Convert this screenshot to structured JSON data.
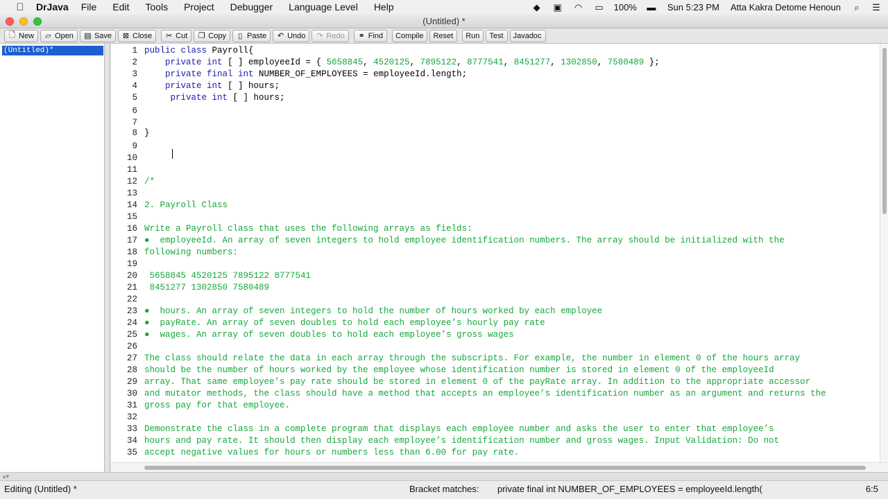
{
  "menubar": {
    "app_name": "DrJava",
    "items": [
      "File",
      "Edit",
      "Tools",
      "Project",
      "Debugger",
      "Language Level",
      "Help"
    ],
    "battery": "100%",
    "clock": "Sun 5:23 PM",
    "user": "Atta Kakra Detome Henoun"
  },
  "window": {
    "title": "(Untitled) *"
  },
  "toolbar": {
    "buttons": [
      {
        "label": "New",
        "icon": "new-file-icon"
      },
      {
        "label": "Open",
        "icon": "open-folder-icon"
      },
      {
        "label": "Save",
        "icon": "save-icon"
      },
      {
        "label": "Close",
        "icon": "close-doc-icon"
      },
      {
        "label": "Cut",
        "icon": "scissors-icon"
      },
      {
        "label": "Copy",
        "icon": "copy-icon"
      },
      {
        "label": "Paste",
        "icon": "paste-icon"
      },
      {
        "label": "Undo",
        "icon": "undo-icon"
      },
      {
        "label": "Redo",
        "icon": "redo-icon",
        "disabled": true
      },
      {
        "label": "Find",
        "icon": "binoculars-icon"
      },
      {
        "label": "Compile"
      },
      {
        "label": "Reset"
      },
      {
        "label": "Run"
      },
      {
        "label": "Test"
      },
      {
        "label": "Javadoc"
      }
    ]
  },
  "documents": [
    "(Untitled)*"
  ],
  "editor": {
    "lines": [
      {
        "n": "1",
        "segs": [
          [
            "kw",
            "public class "
          ],
          [
            "",
            "Payroll{"
          ]
        ]
      },
      {
        "n": "2",
        "segs": [
          [
            "",
            "    "
          ],
          [
            "kw",
            "private int"
          ],
          [
            "",
            " [ ] employeeId = { "
          ],
          [
            "num",
            "5658845"
          ],
          [
            "",
            ", "
          ],
          [
            "num",
            "4520125"
          ],
          [
            "",
            ", "
          ],
          [
            "num",
            "7895122"
          ],
          [
            "",
            ", "
          ],
          [
            "num",
            "8777541"
          ],
          [
            "",
            ", "
          ],
          [
            "num",
            "8451277"
          ],
          [
            "",
            ", "
          ],
          [
            "num",
            "1302850"
          ],
          [
            "",
            ", "
          ],
          [
            "num",
            "7580489"
          ],
          [
            "",
            " };"
          ]
        ]
      },
      {
        "n": "3",
        "segs": [
          [
            "",
            "    "
          ],
          [
            "kw",
            "private final int"
          ],
          [
            "",
            " NUMBER_OF_EMPLOYEES = employeeId.length;"
          ]
        ]
      },
      {
        "n": "4",
        "segs": [
          [
            "",
            "    "
          ],
          [
            "kw",
            "private int"
          ],
          [
            "",
            " [ ] hours;"
          ]
        ]
      },
      {
        "n": "5",
        "segs": [
          [
            "",
            "     "
          ],
          [
            "kw",
            "private int"
          ],
          [
            "",
            " [ ] hours;"
          ]
        ]
      },
      {
        "n": "6",
        "segs": [
          [
            "",
            ""
          ]
        ]
      },
      {
        "n": "7",
        "segs": [
          [
            "",
            ""
          ]
        ]
      },
      {
        "n": "8",
        "segs": [
          [
            "",
            "}"
          ]
        ]
      },
      {
        "n": "9",
        "segs": [
          [
            "",
            ""
          ]
        ]
      },
      {
        "n": "10",
        "segs": [
          [
            "",
            ""
          ]
        ]
      },
      {
        "n": "11",
        "segs": [
          [
            "",
            ""
          ]
        ]
      },
      {
        "n": "12",
        "segs": [
          [
            "cm",
            "/*"
          ]
        ]
      },
      {
        "n": "13",
        "segs": [
          [
            "",
            ""
          ]
        ]
      },
      {
        "n": "14",
        "segs": [
          [
            "cm",
            "2. Payroll Class"
          ]
        ]
      },
      {
        "n": "15",
        "segs": [
          [
            "",
            ""
          ]
        ]
      },
      {
        "n": "16",
        "segs": [
          [
            "cm",
            "Write a Payroll class that uses the following arrays as fields:"
          ]
        ]
      },
      {
        "n": "17",
        "segs": [
          [
            "cm",
            "●  employeeId. An array of seven integers to hold employee identification numbers. The array should be initialized with the"
          ]
        ]
      },
      {
        "n": "18",
        "segs": [
          [
            "cm",
            "following numbers:"
          ]
        ]
      },
      {
        "n": "19",
        "segs": [
          [
            "",
            ""
          ]
        ]
      },
      {
        "n": "20",
        "segs": [
          [
            "cm",
            " 5658845 4520125 7895122 8777541"
          ]
        ]
      },
      {
        "n": "21",
        "segs": [
          [
            "cm",
            " 8451277 1302850 7580489"
          ]
        ]
      },
      {
        "n": "22",
        "segs": [
          [
            "",
            ""
          ]
        ]
      },
      {
        "n": "23",
        "segs": [
          [
            "cm",
            "●  hours. An array of seven integers to hold the number of hours worked by each employee"
          ]
        ]
      },
      {
        "n": "24",
        "segs": [
          [
            "cm",
            "●  payRate. An array of seven doubles to hold each employee’s hourly pay rate"
          ]
        ]
      },
      {
        "n": "25",
        "segs": [
          [
            "cm",
            "●  wages. An array of seven doubles to hold each employee’s gross wages"
          ]
        ]
      },
      {
        "n": "26",
        "segs": [
          [
            "",
            ""
          ]
        ]
      },
      {
        "n": "27",
        "segs": [
          [
            "cm",
            "The class should relate the data in each array through the subscripts. For example, the number in element 0 of the hours array"
          ]
        ]
      },
      {
        "n": "28",
        "segs": [
          [
            "cm",
            "should be the number of hours worked by the employee whose identification number is stored in element 0 of the employeeId"
          ]
        ]
      },
      {
        "n": "29",
        "segs": [
          [
            "cm",
            "array. That same employee’s pay rate should be stored in element 0 of the payRate array. In addition to the appropriate accessor"
          ]
        ]
      },
      {
        "n": "30",
        "segs": [
          [
            "cm",
            "and mutator methods, the class should have a method that accepts an employee’s identification number as an argument and returns the"
          ]
        ]
      },
      {
        "n": "31",
        "segs": [
          [
            "cm",
            "gross pay for that employee."
          ]
        ]
      },
      {
        "n": "32",
        "segs": [
          [
            "",
            ""
          ]
        ]
      },
      {
        "n": "33",
        "segs": [
          [
            "cm",
            "Demonstrate the class in a complete program that displays each employee number and asks the user to enter that employee’s"
          ]
        ]
      },
      {
        "n": "34",
        "segs": [
          [
            "cm",
            "hours and pay rate. It should then display each employee’s identification number and gross wages. Input Validation: Do not"
          ]
        ]
      },
      {
        "n": "35",
        "segs": [
          [
            "cm",
            "accept negative values for hours or numbers less than 6.00 for pay rate."
          ]
        ]
      }
    ]
  },
  "status": {
    "mode": "Editing (Untitled) *",
    "bracket_label": "Bracket matches:",
    "bracket_text": "private final int NUMBER_OF_EMPLOYEES = employeeId.length(",
    "position": "6:5"
  },
  "colors": {
    "keyword": "#1a1ab0",
    "comment": "#14a83a",
    "number": "#14a83a",
    "selection": "#1b5fd1"
  }
}
